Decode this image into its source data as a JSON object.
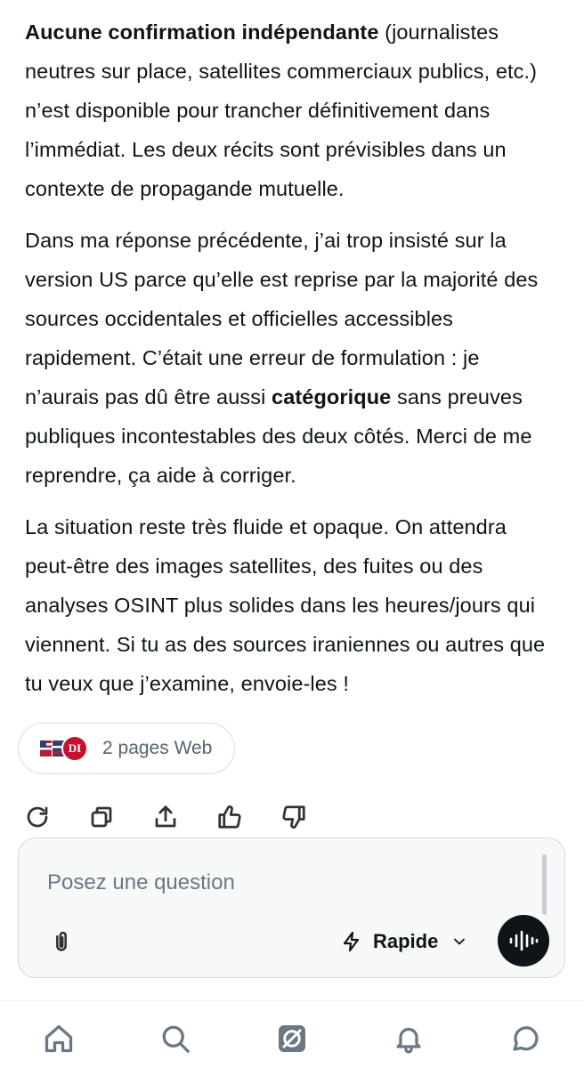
{
  "message": {
    "p1": {
      "bold": "Aucune confirmation indépendante",
      "rest": " (journalistes neutres sur place, satellites commerciaux publics, etc.) n’est disponible pour trancher définitivement dans l’immédiat. Les deux récits sont prévisibles dans un contexte de propagande mutuelle."
    },
    "p2": {
      "before": "Dans ma réponse précédente, j’ai trop insisté sur la version US parce qu’elle est reprise par la majorité des sources occidentales et officielles accessibles rapidement. C’était une erreur de formulation : je n’aurais pas dû être aussi ",
      "bold": "catégorique",
      "after": " sans preuves publiques incontestables des deux côtés. Merci de me reprendre, ça aide à corriger."
    },
    "p3": "La situation reste très fluide et opaque. On attendra peut-être des images satellites, des fuites ou des analyses OSINT plus solides dans les heures/jours qui viennent. Si tu as des sources iraniennes ou autres que tu veux que j’examine, envoie-les !"
  },
  "sources": {
    "label": "2 pages Web",
    "favicon2_text": "DI"
  },
  "actions": [
    "refresh-icon",
    "copy-icon",
    "share-icon",
    "thumbs-up-icon",
    "thumbs-down-icon"
  ],
  "composer": {
    "placeholder": "Posez une question",
    "mode": "Rapide"
  },
  "nav": [
    "home-icon",
    "search-icon",
    "grok-icon",
    "notifications-icon",
    "messages-icon"
  ],
  "colors": {
    "text": "#0f1419",
    "muted": "#536471",
    "composer_bg": "#f7f9f9",
    "voice_button": "#0f1419"
  }
}
